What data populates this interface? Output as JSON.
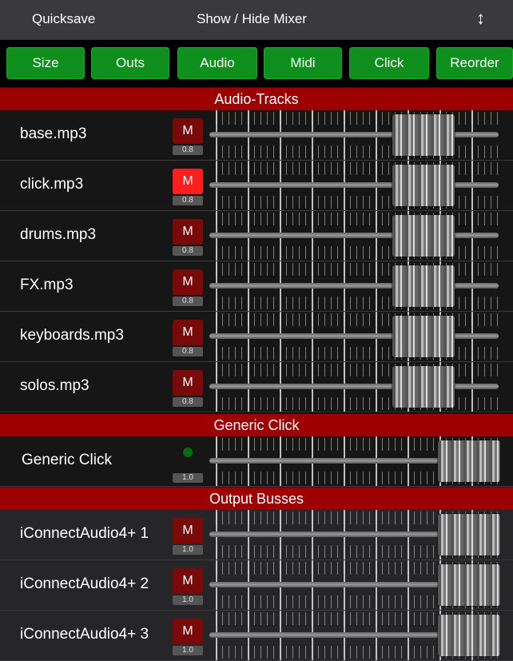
{
  "toolbar": {
    "quicksave": "Quicksave",
    "show_hide_mixer": "Show / Hide Mixer",
    "resize_icon": "↕"
  },
  "buttons": [
    "Size",
    "Outs",
    "Audio",
    "Midi",
    "Click",
    "Reorder"
  ],
  "sections": {
    "audio_tracks": "Audio-Tracks",
    "generic_click": "Generic Click",
    "output_busses": "Output Busses"
  },
  "audio_tracks": [
    {
      "name": "base.mp3",
      "mute": "M",
      "gain": "0.8",
      "muted": false
    },
    {
      "name": "click.mp3",
      "mute": "M",
      "gain": "0.8",
      "muted": true
    },
    {
      "name": "drums.mp3",
      "mute": "M",
      "gain": "0.8",
      "muted": false
    },
    {
      "name": "FX.mp3",
      "mute": "M",
      "gain": "0.8",
      "muted": false
    },
    {
      "name": "keyboards.mp3",
      "mute": "M",
      "gain": "0.8",
      "muted": false
    },
    {
      "name": "solos.mp3",
      "mute": "M",
      "gain": "0.8",
      "muted": false
    }
  ],
  "generic_click": {
    "name": "Generic Click",
    "gain": "1.0"
  },
  "output_busses": [
    {
      "name": "iConnectAudio4+ 1",
      "mute": "M",
      "gain": "1.0"
    },
    {
      "name": "iConnectAudio4+ 2",
      "mute": "M",
      "gain": "1.0"
    },
    {
      "name": "iConnectAudio4+ 3",
      "mute": "M",
      "gain": "1.0"
    }
  ],
  "colors": {
    "accent_green": "#0f8f1e",
    "section_red": "#9c0000",
    "mute_on": "#ff1e1e",
    "mute_off": "#7a0a0a"
  }
}
